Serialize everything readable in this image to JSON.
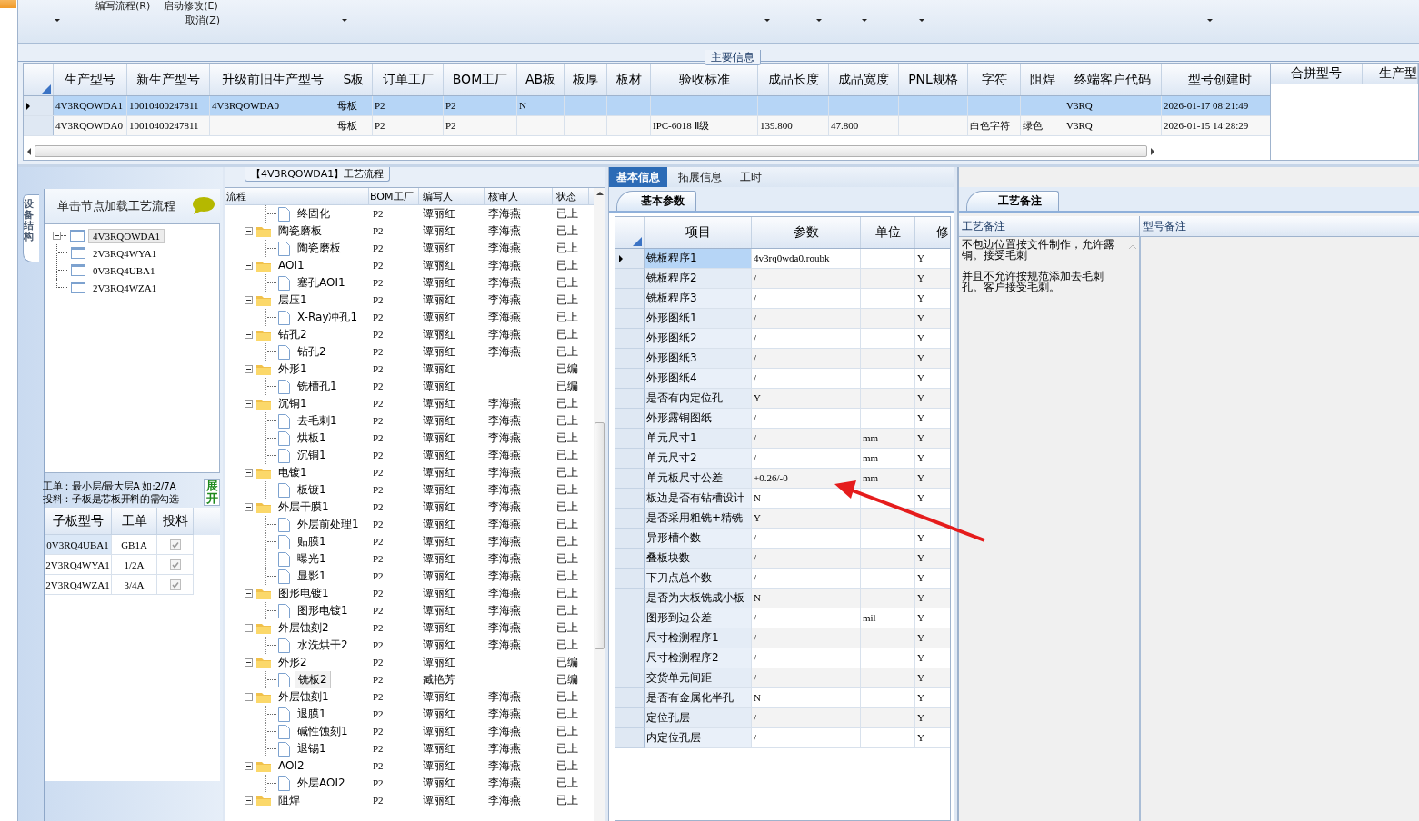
{
  "ribbon": {
    "items": [
      {
        "label": "编写流程(R)"
      },
      {
        "label": "启动修改(E)"
      },
      {
        "label": "取消(Z)"
      }
    ]
  },
  "main_info": {
    "title": "主要信息",
    "columns": [
      "生产型号",
      "新生产型号",
      "升级前旧生产型号",
      "S板",
      "订单工厂",
      "BOM工厂",
      "AB板",
      "板厚",
      "板材",
      "验收标准",
      "成品长度",
      "成品宽度",
      "PNL规格",
      "字符",
      "阻焊",
      "终端客户代码",
      "型号创建时"
    ],
    "rows": [
      {
        "selected": true,
        "cells": [
          "4V3RQOWDA1",
          "10010400247811",
          "4V3RQOWDA0",
          "母板",
          "P2",
          "P2",
          "N",
          null,
          null,
          null,
          null,
          null,
          null,
          null,
          null,
          "V3RQ",
          "2026-01-17 08:21:49"
        ]
      },
      {
        "selected": false,
        "cells": [
          "4V3RQOWDA0",
          "10010400247811",
          null,
          "母板",
          "P2",
          "P2",
          null,
          null,
          null,
          "IPC-6018 Ⅱ级",
          "139.800",
          "47.800",
          null,
          "白色字符",
          "绿色",
          "V3RQ",
          "2026-01-15 14:28:29"
        ]
      }
    ],
    "side_columns": [
      "合拼型号",
      "生产型"
    ]
  },
  "structure_tab": {
    "label": "设备结构"
  },
  "node_tree": {
    "hint": "单击节点加载工艺流程",
    "root": {
      "label": "4V3RQOWDA1",
      "selected": true,
      "expanded": true,
      "children": [
        {
          "label": "2V3RQ4WYA1",
          "selected": false
        },
        {
          "label": "0V3RQ4UBA1",
          "selected": false
        },
        {
          "label": "2V3RQ4WZA1",
          "selected": false
        }
      ]
    }
  },
  "note_lines": [
    "工单：最小层/最大层A 如:2/7A",
    "投料：子板是芯板开料的需勾选"
  ],
  "expand_button": "展开",
  "sub_boards": {
    "columns": [
      "子板型号",
      "工单",
      "投料"
    ],
    "rows": [
      {
        "board": "0V3RQ4UBA1",
        "order": "GB1A",
        "checked": true,
        "selected": true
      },
      {
        "board": "2V3RQ4WYA1",
        "order": "1/2A",
        "checked": true,
        "selected": false
      },
      {
        "board": "2V3RQ4WZA1",
        "order": "3/4A",
        "checked": true,
        "selected": false
      }
    ]
  },
  "process": {
    "title": "【4V3RQOWDA1】工艺流程",
    "columns": [
      "流程",
      "BOM工厂",
      "编写人",
      "核审人",
      "状态"
    ],
    "rows": [
      {
        "label": "终固化",
        "bom": "P2",
        "writer": "谭丽红",
        "reviewer": "李海燕",
        "status": "已上",
        "selected": false
      },
      {
        "label": "陶瓷磨板",
        "bom": "P2",
        "writer": "谭丽红",
        "reviewer": "李海燕",
        "status": "已上",
        "selected": false,
        "expanded": true,
        "children": [
          {
            "label": "陶瓷磨板",
            "bom": "P2",
            "writer": "谭丽红",
            "reviewer": "李海燕",
            "status": "已上",
            "selected": false
          }
        ]
      },
      {
        "label": "AOI1",
        "bom": "P2",
        "writer": "谭丽红",
        "reviewer": "李海燕",
        "status": "已上",
        "selected": false,
        "expanded": true,
        "children": [
          {
            "label": "塞孔AOI1",
            "bom": "P2",
            "writer": "谭丽红",
            "reviewer": "李海燕",
            "status": "已上",
            "selected": false
          }
        ]
      },
      {
        "label": "层压1",
        "bom": "P2",
        "writer": "谭丽红",
        "reviewer": "李海燕",
        "status": "已上",
        "selected": false,
        "expanded": true,
        "children": [
          {
            "label": "X-Ray冲孔1",
            "bom": "P2",
            "writer": "谭丽红",
            "reviewer": "李海燕",
            "status": "已上",
            "selected": false
          }
        ]
      },
      {
        "label": "钻孔2",
        "bom": "P2",
        "writer": "谭丽红",
        "reviewer": "李海燕",
        "status": "已上",
        "selected": false,
        "expanded": true,
        "children": [
          {
            "label": "钻孔2",
            "bom": "P2",
            "writer": "谭丽红",
            "reviewer": "李海燕",
            "status": "已上",
            "selected": false
          }
        ]
      },
      {
        "label": "外形1",
        "bom": "P2",
        "writer": "谭丽红",
        "status": "已编",
        "selected": false,
        "expanded": true,
        "children": [
          {
            "label": "铣槽孔1",
            "bom": "P2",
            "writer": "谭丽红",
            "status": "已编",
            "selected": false
          }
        ]
      },
      {
        "label": "沉铜1",
        "bom": "P2",
        "writer": "谭丽红",
        "reviewer": "李海燕",
        "status": "已上",
        "selected": false,
        "expanded": true,
        "children": [
          {
            "label": "去毛刺1",
            "bom": "P2",
            "writer": "谭丽红",
            "reviewer": "李海燕",
            "status": "已上",
            "selected": false
          },
          {
            "label": "烘板1",
            "bom": "P2",
            "writer": "谭丽红",
            "reviewer": "李海燕",
            "status": "已上",
            "selected": false
          },
          {
            "label": "沉铜1",
            "bom": "P2",
            "writer": "谭丽红",
            "reviewer": "李海燕",
            "status": "已上",
            "selected": false
          }
        ]
      },
      {
        "label": "电镀1",
        "bom": "P2",
        "writer": "谭丽红",
        "reviewer": "李海燕",
        "status": "已上",
        "selected": false,
        "expanded": true,
        "children": [
          {
            "label": "板镀1",
            "bom": "P2",
            "writer": "谭丽红",
            "reviewer": "李海燕",
            "status": "已上",
            "selected": false
          }
        ]
      },
      {
        "label": "外层干膜1",
        "bom": "P2",
        "writer": "谭丽红",
        "reviewer": "李海燕",
        "status": "已上",
        "selected": false,
        "expanded": true,
        "children": [
          {
            "label": "外层前处理1",
            "bom": "P2",
            "writer": "谭丽红",
            "reviewer": "李海燕",
            "status": "已上",
            "selected": false
          },
          {
            "label": "贴膜1",
            "bom": "P2",
            "writer": "谭丽红",
            "reviewer": "李海燕",
            "status": "已上",
            "selected": false
          },
          {
            "label": "曝光1",
            "bom": "P2",
            "writer": "谭丽红",
            "reviewer": "李海燕",
            "status": "已上",
            "selected": false
          },
          {
            "label": "显影1",
            "bom": "P2",
            "writer": "谭丽红",
            "reviewer": "李海燕",
            "status": "已上",
            "selected": false
          }
        ]
      },
      {
        "label": "图形电镀1",
        "bom": "P2",
        "writer": "谭丽红",
        "reviewer": "李海燕",
        "status": "已上",
        "selected": false,
        "expanded": true,
        "children": [
          {
            "label": "图形电镀1",
            "bom": "P2",
            "writer": "谭丽红",
            "reviewer": "李海燕",
            "status": "已上",
            "selected": false
          }
        ]
      },
      {
        "label": "外层蚀刻2",
        "bom": "P2",
        "writer": "谭丽红",
        "reviewer": "李海燕",
        "status": "已上",
        "selected": false,
        "expanded": true,
        "children": [
          {
            "label": "水洗烘干2",
            "bom": "P2",
            "writer": "谭丽红",
            "reviewer": "李海燕",
            "status": "已上",
            "selected": false
          }
        ]
      },
      {
        "label": "外形2",
        "bom": "P2",
        "writer": "谭丽红",
        "status": "已编",
        "selected": false,
        "expanded": true,
        "children": [
          {
            "label": "铣板2",
            "bom": "P2",
            "writer": "臧艳芳",
            "status": "已编",
            "selected": true
          }
        ]
      },
      {
        "label": "外层蚀刻1",
        "bom": "P2",
        "writer": "谭丽红",
        "reviewer": "李海燕",
        "status": "已上",
        "selected": false,
        "expanded": true,
        "children": [
          {
            "label": "退膜1",
            "bom": "P2",
            "writer": "谭丽红",
            "reviewer": "李海燕",
            "status": "已上",
            "selected": false
          },
          {
            "label": "碱性蚀刻1",
            "bom": "P2",
            "writer": "谭丽红",
            "reviewer": "李海燕",
            "status": "已上",
            "selected": false
          },
          {
            "label": "退锡1",
            "bom": "P2",
            "writer": "谭丽红",
            "reviewer": "李海燕",
            "status": "已上",
            "selected": false
          }
        ]
      },
      {
        "label": "AOI2",
        "bom": "P2",
        "writer": "谭丽红",
        "reviewer": "李海燕",
        "status": "已上",
        "selected": false,
        "expanded": true,
        "children": [
          {
            "label": "外层AOI2",
            "bom": "P2",
            "writer": "谭丽红",
            "reviewer": "李海燕",
            "status": "已上",
            "selected": false
          }
        ]
      },
      {
        "label": "阻焊",
        "bom": "P2",
        "writer": "谭丽红",
        "reviewer": "李海燕",
        "status": "已上",
        "selected": false,
        "expanded": true
      }
    ]
  },
  "detail_tabs": [
    {
      "label": "基本信息",
      "selected": true
    },
    {
      "label": "拓展信息",
      "selected": false
    },
    {
      "label": "工时",
      "selected": false
    }
  ],
  "sub_tab": "基本参数",
  "params": {
    "columns": [
      "项目",
      "参数",
      "单位",
      "修"
    ],
    "rows": [
      {
        "item": "铣板程序1",
        "value": "4v3rq0wda0.roubk",
        "modified": "Y",
        "selected": true
      },
      {
        "item": "铣板程序2",
        "value": "/",
        "modified": "Y",
        "selected": false
      },
      {
        "item": "铣板程序3",
        "value": "/",
        "modified": "Y",
        "selected": false
      },
      {
        "item": "外形图纸1",
        "value": "/",
        "modified": "Y",
        "selected": false
      },
      {
        "item": "外形图纸2",
        "value": "/",
        "modified": "Y",
        "selected": false
      },
      {
        "item": "外形图纸3",
        "value": "/",
        "modified": "Y",
        "selected": false
      },
      {
        "item": "外形图纸4",
        "value": "/",
        "modified": "Y",
        "selected": false
      },
      {
        "item": "是否有内定位孔",
        "value": "Y",
        "modified": "Y",
        "selected": false
      },
      {
        "item": "外形露铜图纸",
        "value": "/",
        "modified": "Y",
        "selected": false
      },
      {
        "item": "单元尺寸1",
        "value": "/",
        "unit": "mm",
        "modified": "Y",
        "selected": false
      },
      {
        "item": "单元尺寸2",
        "value": "/",
        "unit": "mm",
        "modified": "Y",
        "selected": false
      },
      {
        "item": "单元板尺寸公差",
        "value": "+0.26/-0",
        "unit": "mm",
        "modified": "Y",
        "selected": false
      },
      {
        "item": "板边是否有钻槽设计",
        "value": "N",
        "modified": "Y",
        "selected": false
      },
      {
        "item": "是否采用粗铣+精铣",
        "value": "Y",
        "selected": false
      },
      {
        "item": "异形槽个数",
        "value": "/",
        "modified": "Y",
        "selected": false
      },
      {
        "item": "叠板块数",
        "value": "/",
        "modified": "Y",
        "selected": false
      },
      {
        "item": "下刀点总个数",
        "value": "/",
        "modified": "Y",
        "selected": false
      },
      {
        "item": "是否为大板铣成小板",
        "value": "N",
        "modified": "Y",
        "selected": false
      },
      {
        "item": "图形到边公差",
        "value": "/",
        "unit": "mil",
        "modified": "Y",
        "selected": false
      },
      {
        "item": "尺寸检测程序1",
        "value": "/",
        "modified": "Y",
        "selected": false
      },
      {
        "item": "尺寸检测程序2",
        "value": "/",
        "modified": "Y",
        "selected": false
      },
      {
        "item": "交货单元间距",
        "value": "/",
        "modified": "Y",
        "selected": false
      },
      {
        "item": "是否有金属化半孔",
        "value": "N",
        "modified": "Y",
        "selected": false
      },
      {
        "item": "定位孔层",
        "value": "/",
        "modified": "Y",
        "selected": false
      },
      {
        "item": "内定位孔层",
        "value": "/",
        "modified": "Y",
        "selected": false
      }
    ]
  },
  "notes": {
    "tab": "工艺备注",
    "columns": [
      "工艺备注",
      "型号备注"
    ],
    "paragraphs": [
      "不包边位置按文件制作，允许露铜。接受毛刺",
      "并且不允许按规范添加去毛刺孔。客户接受毛刺。"
    ]
  }
}
